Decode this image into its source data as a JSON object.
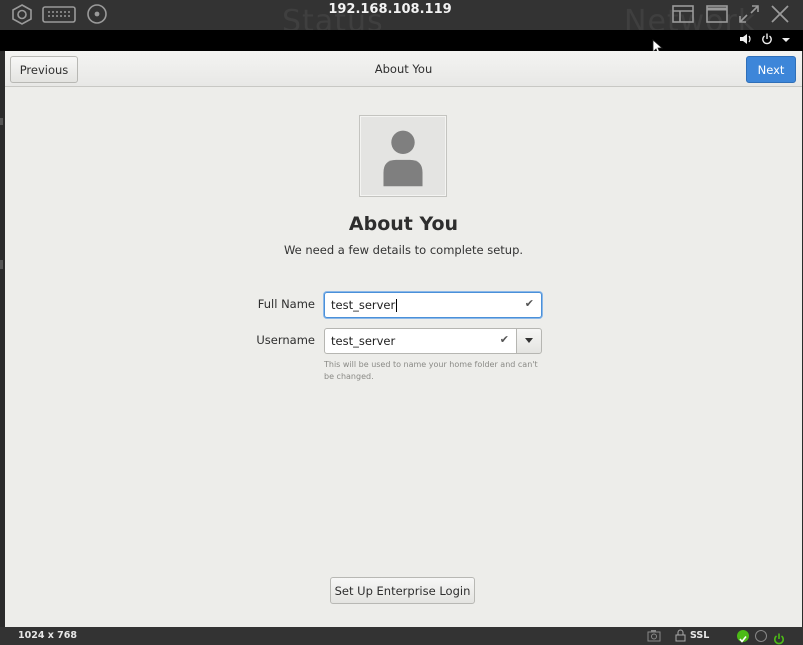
{
  "viewer": {
    "title": "192.168.108.119",
    "ghost_left": "Status",
    "ghost_right": "Network",
    "resolution": "1024 x 768",
    "ssl_label": "SSL",
    "icons": [
      "vm-settings-icon",
      "keyboard-icon",
      "media-icon",
      "window-layout-icon",
      "window-icon",
      "fullscreen-icon",
      "close-icon"
    ]
  },
  "panel": {
    "icons": [
      "volume-icon",
      "power-icon",
      "chevron-down-icon"
    ]
  },
  "header": {
    "previous_label": "Previous",
    "title": "About You",
    "next_label": "Next"
  },
  "main": {
    "title": "About You",
    "subtitle": "We need a few details to complete setup.",
    "full_name_label": "Full Name",
    "full_name_value": "test_server",
    "username_label": "Username",
    "username_value": "test_server",
    "username_hint": "This will be used to name your home folder and can't be changed.",
    "enterprise_button": "Set Up Enterprise Login"
  },
  "colors": {
    "accent": "#3d86d9",
    "background": "#ededea",
    "status_ok": "#4cbb17"
  }
}
